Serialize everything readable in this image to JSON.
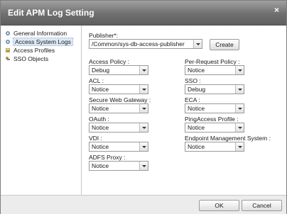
{
  "window": {
    "title": "Edit APM Log Setting",
    "close_glyph": "×"
  },
  "sidebar": {
    "items": [
      {
        "label": "General Information",
        "icon": "gear-icon",
        "active": false
      },
      {
        "label": "Access System Logs",
        "icon": "gear-icon",
        "active": true
      },
      {
        "label": "Access Profiles",
        "icon": "profile-icon",
        "active": false
      },
      {
        "label": "SSO Objects",
        "icon": "sso-icon",
        "active": false
      }
    ]
  },
  "publisher": {
    "label": "Publisher*:",
    "value": "/Common/sys-db-access-publisher",
    "create_label": "Create"
  },
  "fields": {
    "access_policy": {
      "label": "Access Policy :",
      "value": "Debug"
    },
    "per_request_policy": {
      "label": "Per-Request Policy :",
      "value": "Notice"
    },
    "acl": {
      "label": "ACL :",
      "value": "Notice"
    },
    "sso": {
      "label": "SSO :",
      "value": "Debug"
    },
    "secure_web_gateway": {
      "label": "Secure Web Gateway :",
      "value": "Notice"
    },
    "eca": {
      "label": "ECA :",
      "value": "Notice"
    },
    "oauth": {
      "label": "OAuth :",
      "value": "Notice"
    },
    "pingaccess_profile": {
      "label": "PingAccess Profile :",
      "value": "Notice"
    },
    "vdi": {
      "label": "VDI :",
      "value": "Notice"
    },
    "endpoint_management_system": {
      "label": "Endpoint Management System :",
      "value": "Notice"
    },
    "adfs_proxy": {
      "label": "ADFS Proxy :",
      "value": "Notice"
    }
  },
  "footer": {
    "ok_label": "OK",
    "cancel_label": "Cancel"
  },
  "colors": {
    "titlebar": "#6f6f6f",
    "accent": "#dde8f6"
  }
}
